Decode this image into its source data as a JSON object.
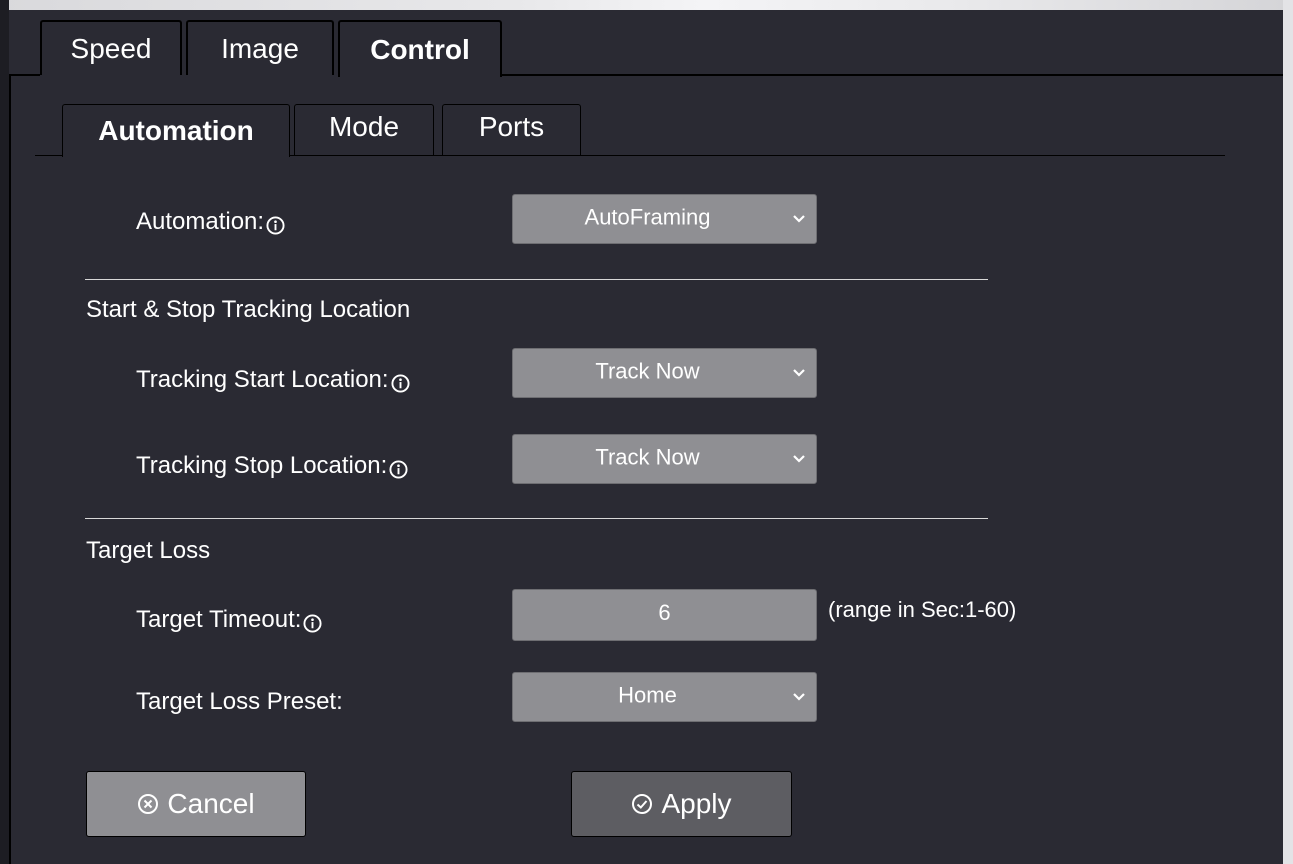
{
  "tabs": [
    {
      "label": "Speed",
      "active": false
    },
    {
      "label": "Image",
      "active": false
    },
    {
      "label": "Control",
      "active": true
    }
  ],
  "subtabs": [
    {
      "label": "Automation",
      "active": true
    },
    {
      "label": "Mode",
      "active": false
    },
    {
      "label": "Ports",
      "active": false
    }
  ],
  "automation": {
    "label": "Automation:",
    "value": "AutoFraming",
    "info_icon": "info-icon"
  },
  "tracking": {
    "section_title": "Start & Stop Tracking Location",
    "start_label": "Tracking Start Location:",
    "start_value": "Track Now",
    "stop_label": "Tracking Stop Location:",
    "stop_value": "Track Now"
  },
  "target_loss": {
    "section_title": "Target Loss",
    "timeout_label": "Target Timeout:",
    "timeout_value": "6",
    "timeout_hint": "(range in Sec:1-60)",
    "preset_label": "Target Loss Preset:",
    "preset_value": "Home"
  },
  "buttons": {
    "cancel_label": "Cancel",
    "cancel_icon": "cancel-circle-icon",
    "apply_label": "Apply",
    "apply_icon": "check-circle-icon"
  },
  "colors": {
    "background": "#2a2a33",
    "control_gray": "#8f8f93",
    "apply_gray": "#5d5d62"
  }
}
